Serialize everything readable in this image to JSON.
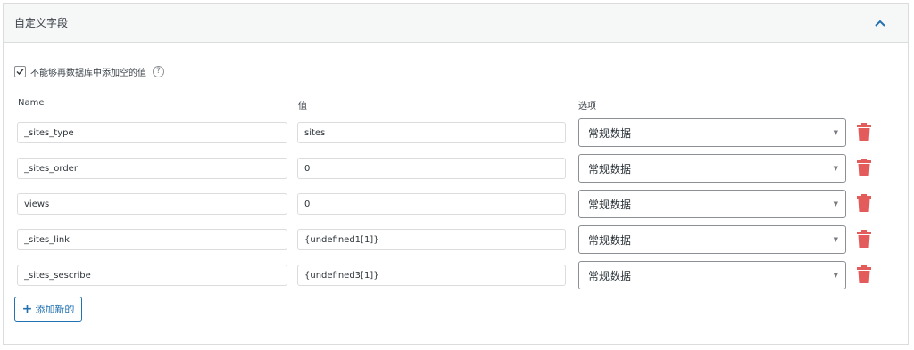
{
  "panel": {
    "title": "自定义字段"
  },
  "option": {
    "checked": true,
    "label": "不能够再数据库中添加空的值",
    "help_glyph": "?"
  },
  "columns": {
    "name": "Name",
    "value": "值",
    "options": "选项"
  },
  "rows": [
    {
      "name": "_sites_type",
      "value": "sites",
      "option": "常规数据"
    },
    {
      "name": "_sites_order",
      "value": "0",
      "option": "常规数据"
    },
    {
      "name": "views",
      "value": "0",
      "option": "常规数据"
    },
    {
      "name": "_sites_link",
      "value": "{undefined1[1]}",
      "option": "常规数据"
    },
    {
      "name": "_sites_sescribe",
      "value": "{undefined3[1]}",
      "option": "常规数据"
    }
  ],
  "add_button": {
    "label": "添加新的"
  },
  "colors": {
    "accent": "#2271b1",
    "delete": "#e35b5b",
    "border": "#dcdcde"
  },
  "icons": {
    "collapse": "chevron-up-icon",
    "delete": "trash-icon",
    "add": "plus-icon",
    "help": "help-circle-icon",
    "check": "checkmark-icon"
  }
}
